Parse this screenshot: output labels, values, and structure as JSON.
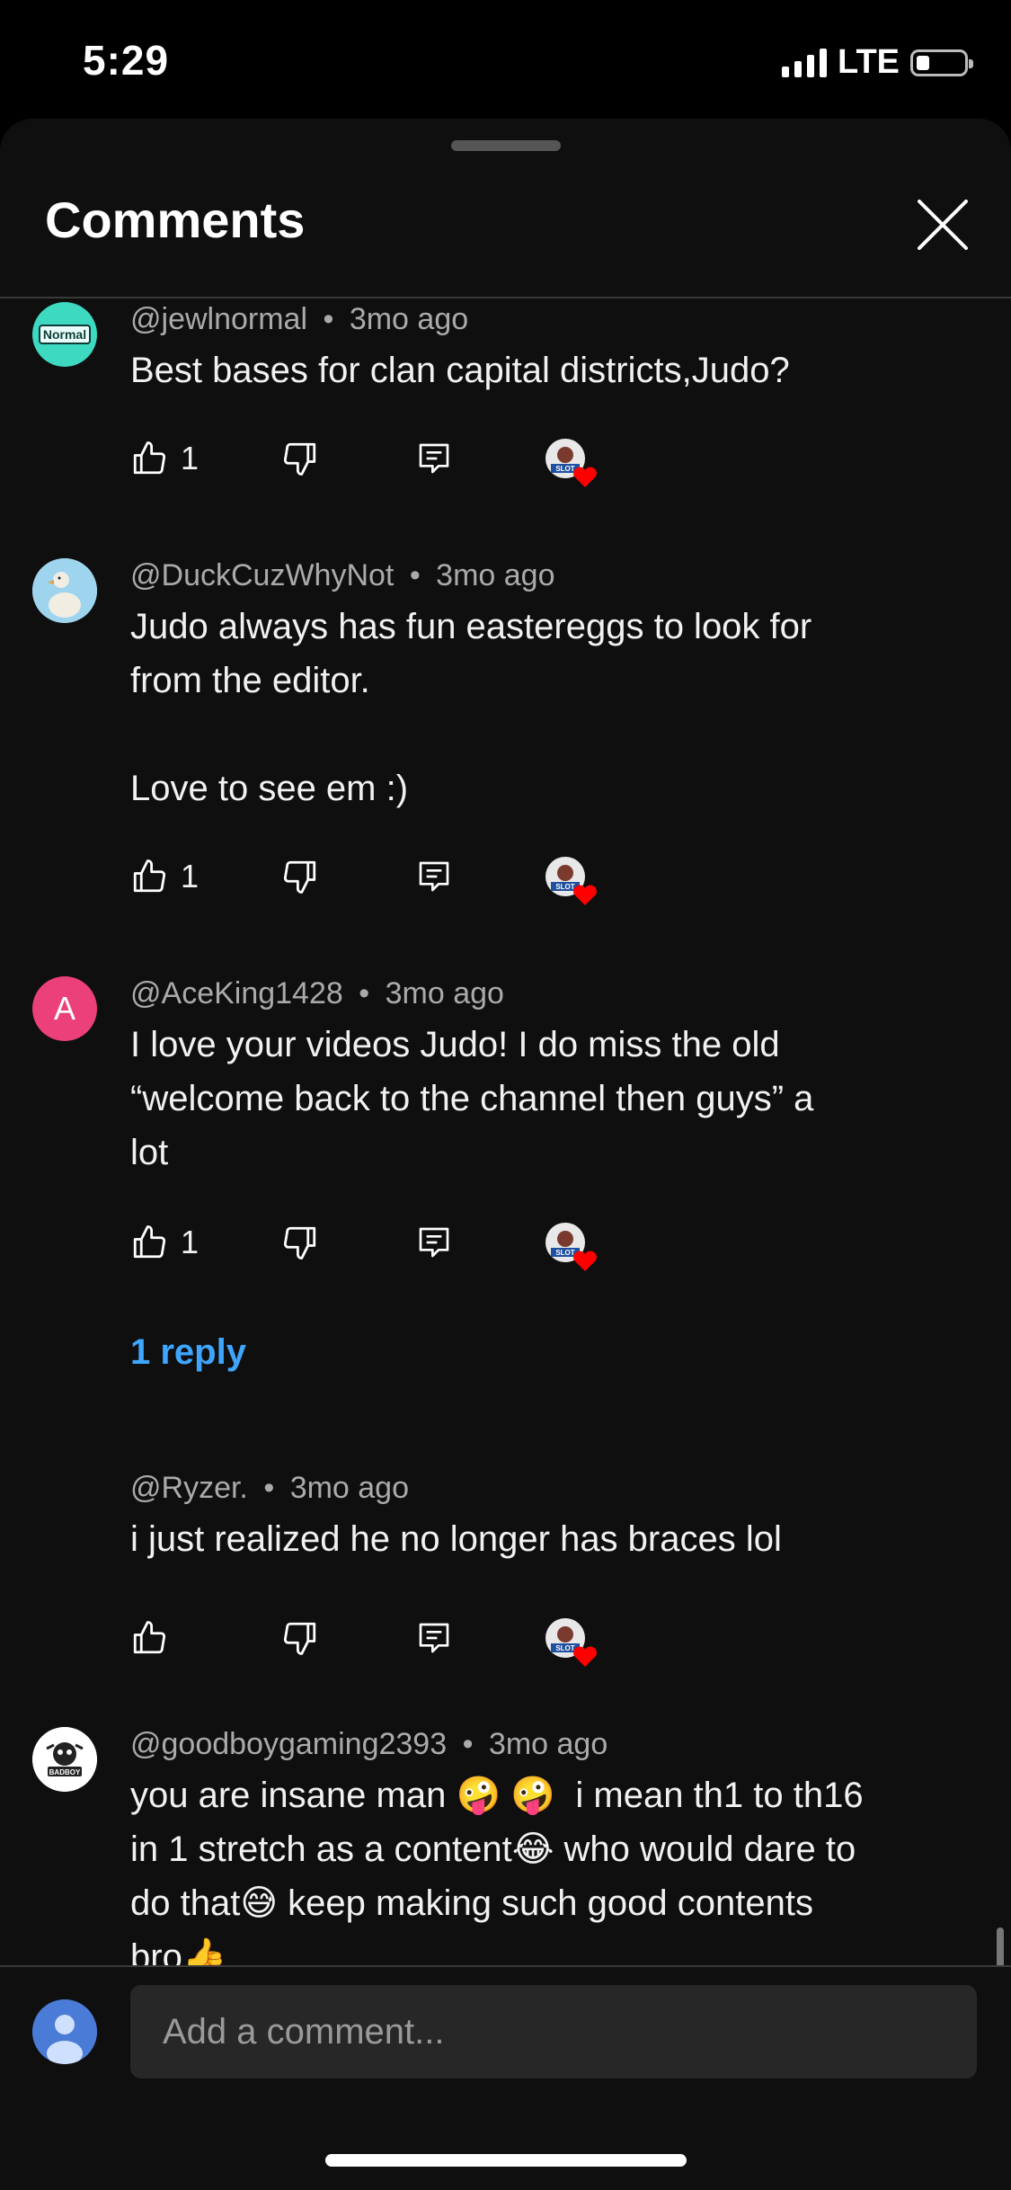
{
  "status_bar": {
    "time": "5:29",
    "network": "LTE"
  },
  "sheet": {
    "title": "Comments"
  },
  "comments": [
    {
      "avatar_text": "Normal",
      "author": "@jewlnormal",
      "separator": "•",
      "time": "3mo ago",
      "text": "Best bases for clan capital districts,Judo?",
      "likes": "1"
    },
    {
      "author": "@DuckCuzWhyNot",
      "separator": "•",
      "time": "3mo ago",
      "text": "Judo always has fun eastereggs to look for\nfrom the editor.\n\nLove to see em :)",
      "likes": "1"
    },
    {
      "avatar_text": "A",
      "author": "@AceKing1428",
      "separator": "•",
      "time": "3mo ago",
      "text": "I love your videos Judo! I do miss the old\n“welcome back to the channel then guys” a\nlot",
      "likes": "1",
      "reply_label": "1 reply"
    },
    {
      "author": "@Ryzer.",
      "separator": "•",
      "time": "3mo ago",
      "text": "i just realized he no longer has braces lol",
      "likes": ""
    },
    {
      "avatar_text": "BADBOY",
      "author": "@goodboygaming2393",
      "separator": "•",
      "time": "3mo ago",
      "text": "you are insane man 🤪 🤪  i mean th1 to th16\nin 1 stretch as a content😂 who would dare to\ndo that😅 keep making such good contents\nbro👍"
    }
  ],
  "creator_badge": {
    "text": "SLOT"
  },
  "composer": {
    "placeholder": "Add a comment..."
  },
  "colors": {
    "background": "#0f0f0f",
    "link": "#3ea6ff",
    "heart": "#ff0000",
    "avatar_jewlnormal": "#3dd9c1",
    "avatar_aceking": "#ec407a",
    "composer_avatar": "#4a7bd6"
  },
  "icons": [
    "thumbs-up-icon",
    "thumbs-down-icon",
    "reply-icon",
    "creator-heart-icon",
    "close-icon"
  ]
}
